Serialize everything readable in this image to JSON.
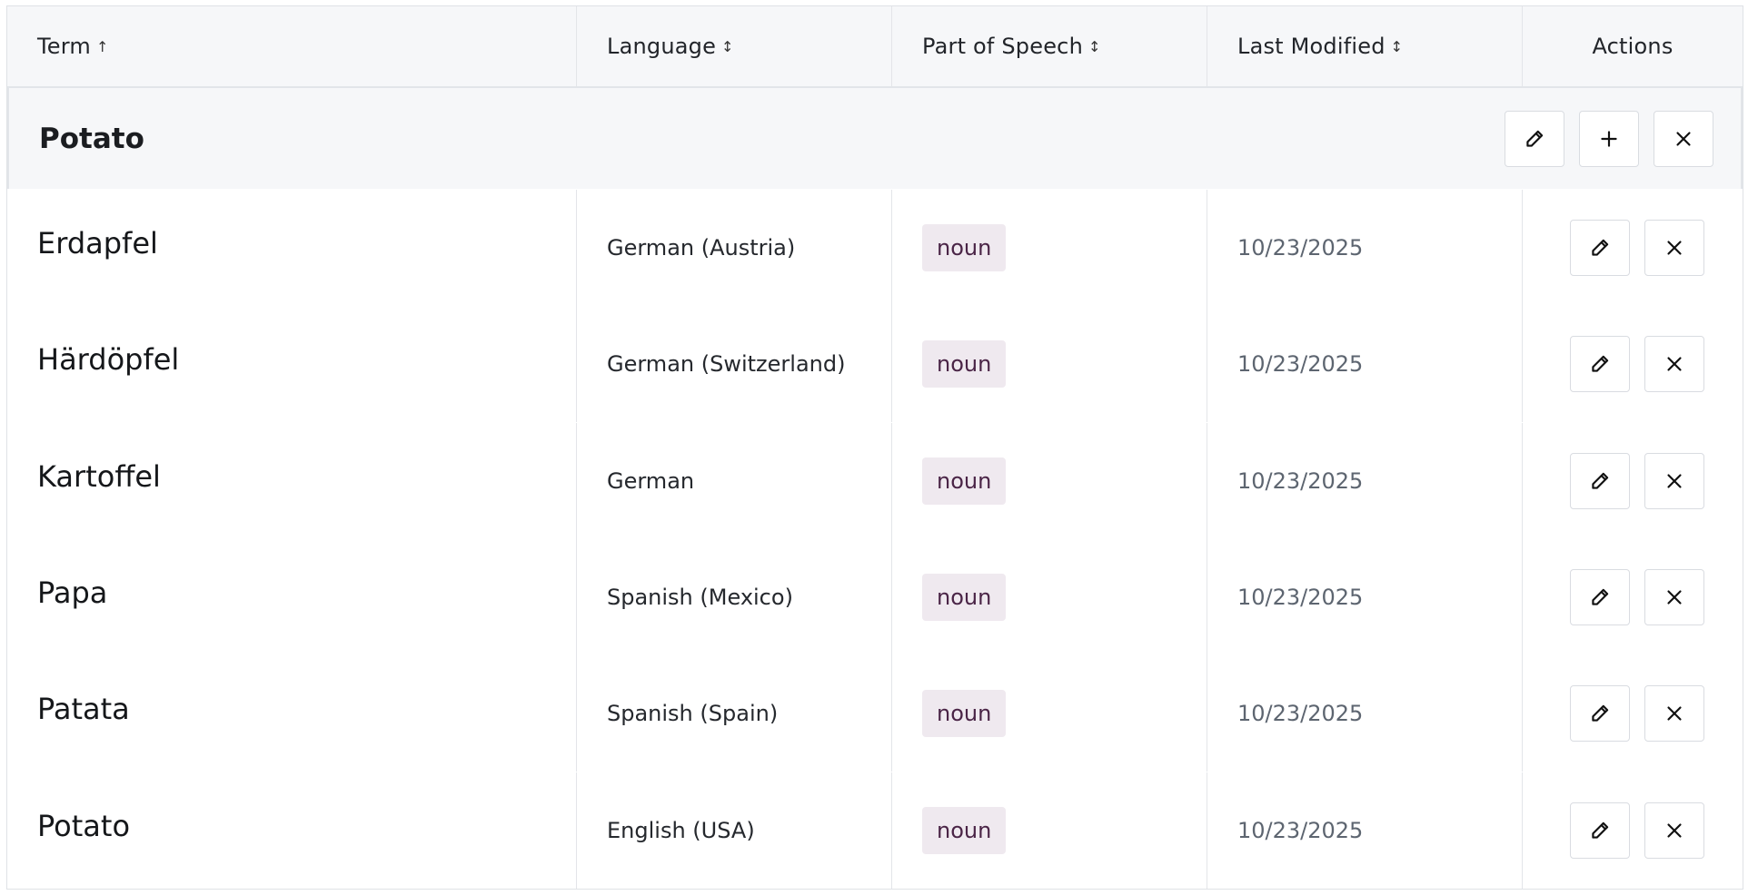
{
  "header": {
    "term": "Term",
    "term_sort": "↑",
    "language": "Language",
    "language_sort": "↕",
    "part_of_speech": "Part of Speech",
    "pos_sort": "↕",
    "last_modified": "Last Modified",
    "modified_sort": "↕",
    "actions": "Actions"
  },
  "group": {
    "term": "Potato",
    "actions": [
      "edit",
      "add",
      "delete"
    ]
  },
  "icons": {
    "edit": "pencil-icon",
    "add": "plus-icon",
    "delete": "close-icon"
  },
  "rows": [
    {
      "term": "Erdapfel",
      "language": "German (Austria)",
      "pos": "noun",
      "modified": "10/23/2025"
    },
    {
      "term": "Härdöpfel",
      "language": "German (Switzerland)",
      "pos": "noun",
      "modified": "10/23/2025"
    },
    {
      "term": "Kartoffel",
      "language": "German",
      "pos": "noun",
      "modified": "10/23/2025"
    },
    {
      "term": "Papa",
      "language": "Spanish (Mexico)",
      "pos": "noun",
      "modified": "10/23/2025"
    },
    {
      "term": "Patata",
      "language": "Spanish (Spain)",
      "pos": "noun",
      "modified": "10/23/2025"
    },
    {
      "term": "Potato",
      "language": "English (USA)",
      "pos": "noun",
      "modified": "10/23/2025"
    }
  ],
  "colors": {
    "header_bg": "#f6f7f9",
    "badge_bg": "#efe9ef",
    "badge_text": "#4a2446",
    "date_text": "#5d6570"
  }
}
